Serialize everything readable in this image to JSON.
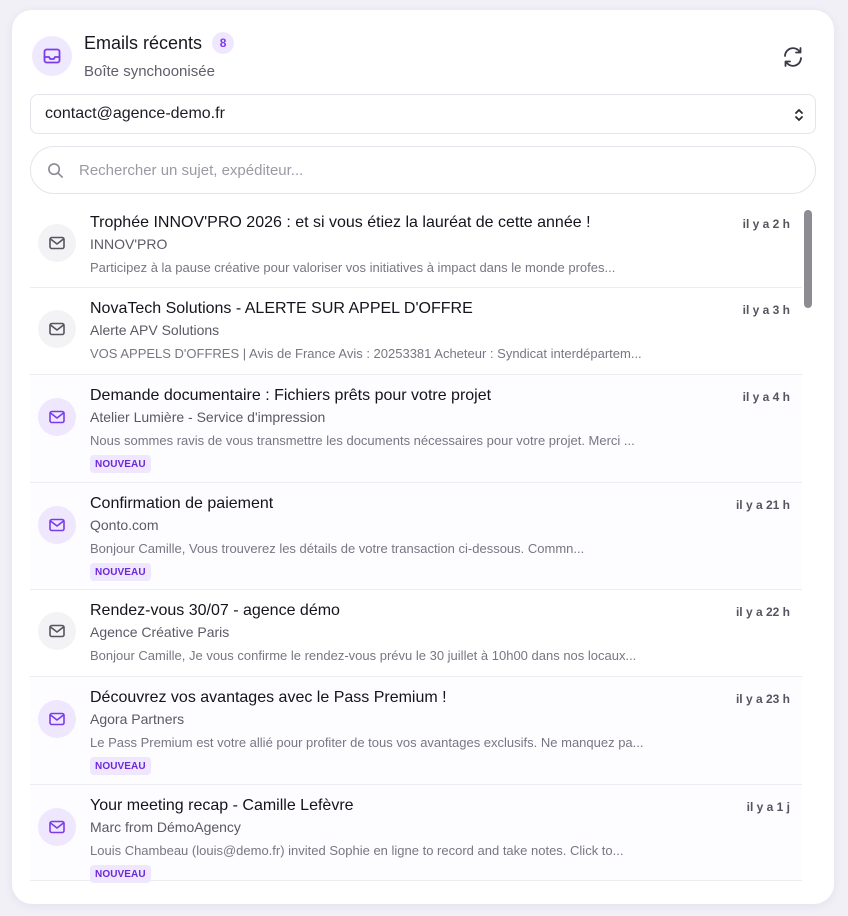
{
  "header": {
    "title": "Emails récents",
    "count": "8",
    "subtitle": "Boîte synchoonisée",
    "icon": "inbox-icon",
    "refresh_icon": "refresh-icon"
  },
  "account_select": {
    "value": "contact@agence-demo.fr"
  },
  "search": {
    "placeholder": "Rechercher un sujet, expéditeur..."
  },
  "colors": {
    "accent": "#7c3aed",
    "accent_light": "#efe7fe"
  },
  "emails": [
    {
      "subject": "Trophée INNOV'PRO 2026 : et si vous étiez la lauréat de cette année !",
      "sender": "INNOV'PRO",
      "preview": "Participez à la pause créative pour valoriser vos initiatives à impact dans le monde profes...",
      "time": "il y a 2 h",
      "unread": false,
      "badge": ""
    },
    {
      "subject": "NovaTech Solutions - ALERTE SUR APPEL D'OFFRE",
      "sender": "Alerte APV Solutions",
      "preview": "VOS APPELS D'OFFRES | Avis de France Avis : 20253381 Acheteur : Syndicat interdépartem...",
      "time": "il y a 3 h",
      "unread": false,
      "badge": ""
    },
    {
      "subject": "Demande documentaire : Fichiers prêts pour votre projet",
      "sender": "Atelier Lumière - Service d'impression",
      "preview": "Nous sommes ravis de vous transmettre les documents nécessaires pour votre projet. Merci ...",
      "time": "il y a 4 h",
      "unread": true,
      "badge": "NOUVEAU"
    },
    {
      "subject": "Confirmation de paiement",
      "sender": "Qonto.com",
      "preview": "Bonjour Camille, Vous trouverez les détails de votre transaction ci-dessous. Commn...",
      "time": "il y a 21 h",
      "unread": true,
      "badge": "NOUVEAU"
    },
    {
      "subject": "Rendez-vous 30/07 - agence démo",
      "sender": "Agence Créative Paris",
      "preview": "Bonjour Camille, Je vous confirme le rendez-vous prévu le 30 juillet à 10h00 dans nos locaux...",
      "time": "il y a 22 h",
      "unread": false,
      "badge": ""
    },
    {
      "subject": "Découvrez vos avantages avec le Pass Premium !",
      "sender": "Agora Partners",
      "preview": "Le Pass Premium est votre allié pour profiter de tous vos avantages exclusifs. Ne manquez pa...",
      "time": "il y a 23 h",
      "unread": true,
      "badge": "NOUVEAU"
    },
    {
      "subject": "Your meeting recap - Camille Lefèvre",
      "sender": "Marc from DémoAgency",
      "preview": "Louis Chambeau (louis@demo.fr) invited Sophie en ligne to record and take notes. Click to...",
      "time": "il y a 1 j",
      "unread": true,
      "badge": "NOUVEAU"
    }
  ]
}
